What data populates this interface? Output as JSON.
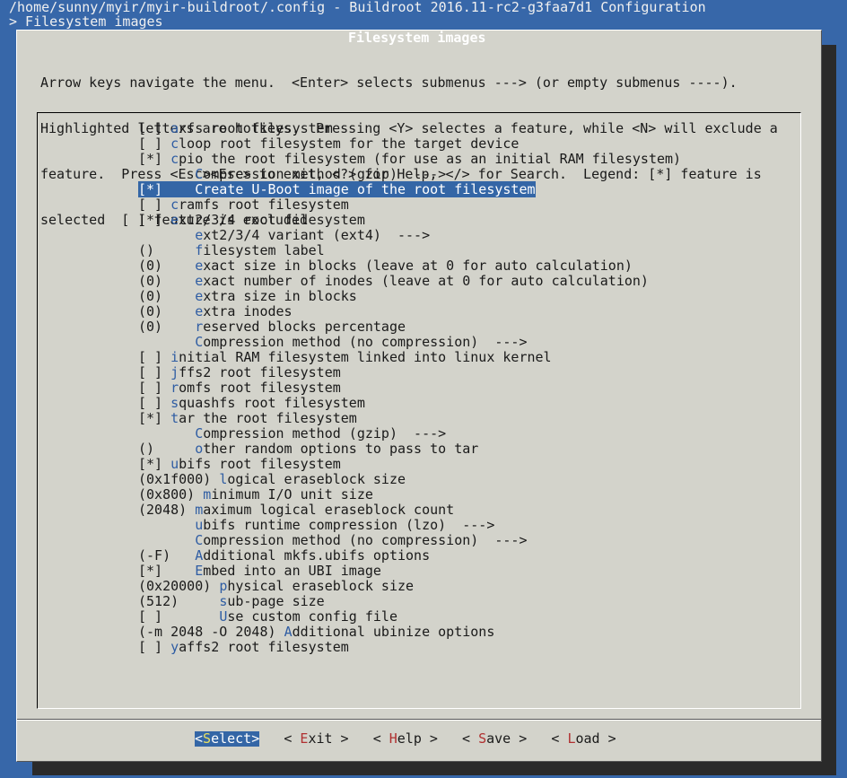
{
  "header": {
    "path_line": "/home/sunny/myir/myir-buildroot/.config - Buildroot 2016.11-rc2-g3faa7d1 Configuration",
    "breadcrumb": "> Filesystem images"
  },
  "dialog": {
    "title": "Filesystem images",
    "help_lines": [
      "Arrow keys navigate the menu.  <Enter> selects submenus ---> (or empty submenus ----).",
      "Highlighted letters are hotkeys.  Pressing <Y> selectes a feature, while <N> will exclude a",
      "feature.  Press <Esc><Esc> to exit, <?> for Help, </> for Search.  Legend: [*] feature is",
      "selected  [ ] feature is excluded"
    ]
  },
  "menu": {
    "items": [
      {
        "prefix": "[ ] ",
        "hotkey": "a",
        "rest": "xfs root filesystem"
      },
      {
        "prefix": "[ ] ",
        "hotkey": "c",
        "rest": "loop root filesystem for the target device"
      },
      {
        "prefix": "[*] ",
        "hotkey": "c",
        "rest": "pio the root filesystem (for use as an initial RAM filesystem)"
      },
      {
        "prefix": "       ",
        "hotkey": "C",
        "rest": "ompression method (gzip)  --->"
      },
      {
        "prefix": "[*]    ",
        "hotkey": "C",
        "rest": "reate U-Boot image of the root filesystem",
        "selected": true
      },
      {
        "prefix": "[ ] ",
        "hotkey": "c",
        "rest": "ramfs root filesystem"
      },
      {
        "prefix": "[*] ",
        "hotkey": "e",
        "rest": "xt2/3/4 root filesystem"
      },
      {
        "prefix": "       ",
        "hotkey": "e",
        "rest": "xt2/3/4 variant (ext4)  --->"
      },
      {
        "prefix": "()     ",
        "hotkey": "f",
        "rest": "ilesystem label"
      },
      {
        "prefix": "(0)    ",
        "hotkey": "e",
        "rest": "xact size in blocks (leave at 0 for auto calculation)"
      },
      {
        "prefix": "(0)    ",
        "hotkey": "e",
        "rest": "xact number of inodes (leave at 0 for auto calculation)"
      },
      {
        "prefix": "(0)    ",
        "hotkey": "e",
        "rest": "xtra size in blocks"
      },
      {
        "prefix": "(0)    ",
        "hotkey": "e",
        "rest": "xtra inodes"
      },
      {
        "prefix": "(0)    ",
        "hotkey": "r",
        "rest": "eserved blocks percentage"
      },
      {
        "prefix": "       ",
        "hotkey": "C",
        "rest": "ompression method (no compression)  --->"
      },
      {
        "prefix": "[ ] ",
        "hotkey": "i",
        "rest": "nitial RAM filesystem linked into linux kernel"
      },
      {
        "prefix": "[ ] ",
        "hotkey": "j",
        "rest": "ffs2 root filesystem"
      },
      {
        "prefix": "[ ] ",
        "hotkey": "r",
        "rest": "omfs root filesystem"
      },
      {
        "prefix": "[ ] ",
        "hotkey": "s",
        "rest": "quashfs root filesystem"
      },
      {
        "prefix": "[*] ",
        "hotkey": "t",
        "rest": "ar the root filesystem"
      },
      {
        "prefix": "       ",
        "hotkey": "C",
        "rest": "ompression method (gzip)  --->"
      },
      {
        "prefix": "()     ",
        "hotkey": "o",
        "rest": "ther random options to pass to tar"
      },
      {
        "prefix": "[*] ",
        "hotkey": "u",
        "rest": "bifs root filesystem"
      },
      {
        "prefix": "(0x1f000) ",
        "hotkey": "l",
        "rest": "ogical eraseblock size"
      },
      {
        "prefix": "(0x800) ",
        "hotkey": "m",
        "rest": "inimum I/O unit size"
      },
      {
        "prefix": "(2048) ",
        "hotkey": "m",
        "rest": "aximum logical eraseblock count"
      },
      {
        "prefix": "       ",
        "hotkey": "u",
        "rest": "bifs runtime compression (lzo)  --->"
      },
      {
        "prefix": "       ",
        "hotkey": "C",
        "rest": "ompression method (no compression)  --->"
      },
      {
        "prefix": "(-F)   ",
        "hotkey": "A",
        "rest": "dditional mkfs.ubifs options"
      },
      {
        "prefix": "[*]    ",
        "hotkey": "E",
        "rest": "mbed into an UBI image"
      },
      {
        "prefix": "(0x20000) ",
        "hotkey": "p",
        "rest": "hysical eraseblock size"
      },
      {
        "prefix": "(512)     ",
        "hotkey": "s",
        "rest": "ub-page size"
      },
      {
        "prefix": "[ ]       ",
        "hotkey": "U",
        "rest": "se custom config file"
      },
      {
        "prefix": "(-m 2048 -O 2048) ",
        "hotkey": "A",
        "rest": "dditional ubinize options"
      },
      {
        "prefix": "[ ] ",
        "hotkey": "y",
        "rest": "affs2 root filesystem"
      }
    ]
  },
  "buttons": [
    {
      "left": "<",
      "hotkey": "S",
      "rest": "elect",
      "right": ">",
      "active": true
    },
    {
      "left": "< ",
      "hotkey": "E",
      "rest": "xit",
      "right": " >"
    },
    {
      "left": "< ",
      "hotkey": "H",
      "rest": "elp",
      "right": " >"
    },
    {
      "left": "< ",
      "hotkey": "S",
      "rest": "ave",
      "right": " >"
    },
    {
      "left": "< ",
      "hotkey": "L",
      "rest": "oad",
      "right": " >"
    }
  ]
}
